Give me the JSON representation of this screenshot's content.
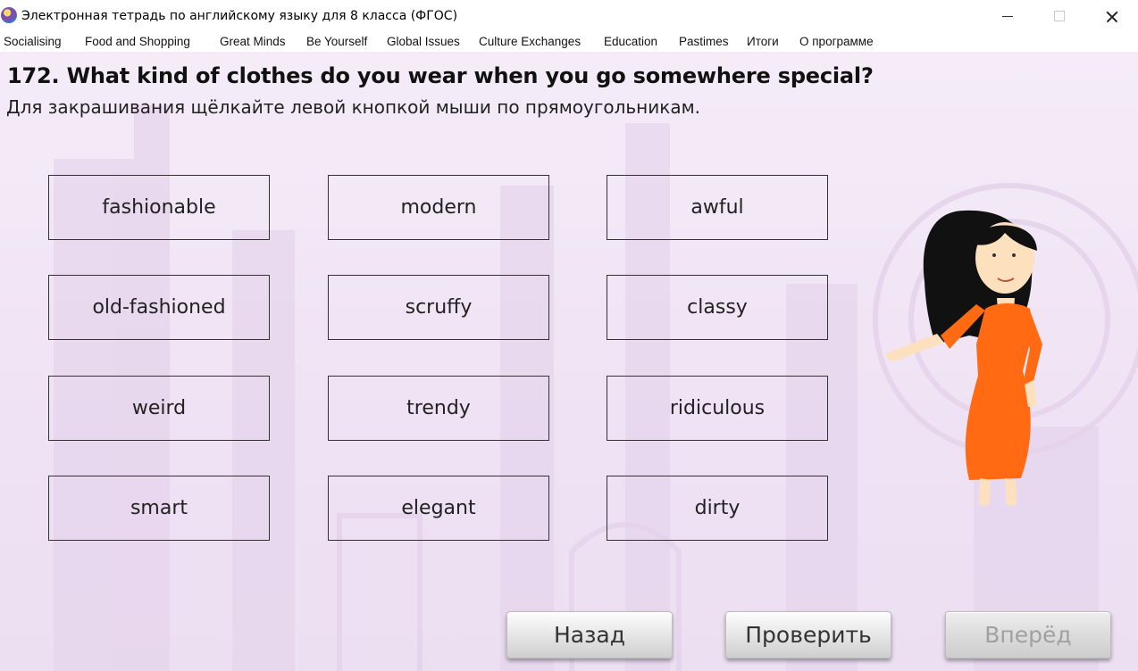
{
  "window": {
    "title": "Электронная тетрадь по английскому языку для 8 класса (ФГОС)"
  },
  "menu": {
    "items": [
      {
        "label": "Socialising"
      },
      {
        "label": "Food and Shopping"
      },
      {
        "label": "Great Minds"
      },
      {
        "label": "Be Yourself"
      },
      {
        "label": "Global Issues"
      },
      {
        "label": "Culture Exchanges"
      },
      {
        "label": "Education"
      },
      {
        "label": "Pastimes"
      },
      {
        "label": "Итоги"
      },
      {
        "label": "О программе"
      }
    ]
  },
  "exercise": {
    "heading": "172. What kind of clothes do you wear when you go somewhere special?",
    "instruction": "Для закрашивания щёлкайте левой кнопкой мыши по прямоугольникам.",
    "words": [
      "fashionable",
      "modern",
      "awful",
      "old-fashioned",
      "scruffy",
      "classy",
      "weird",
      "trendy",
      "ridiculous",
      "smart",
      "elegant",
      "dirty"
    ]
  },
  "nav": {
    "back_label": "Назад",
    "check_label": "Проверить",
    "forward_label": "Вперёд",
    "forward_disabled": true
  },
  "colors": {
    "background": "#f1e6f5",
    "dress": "#ff6a13",
    "hair": "#111111"
  }
}
